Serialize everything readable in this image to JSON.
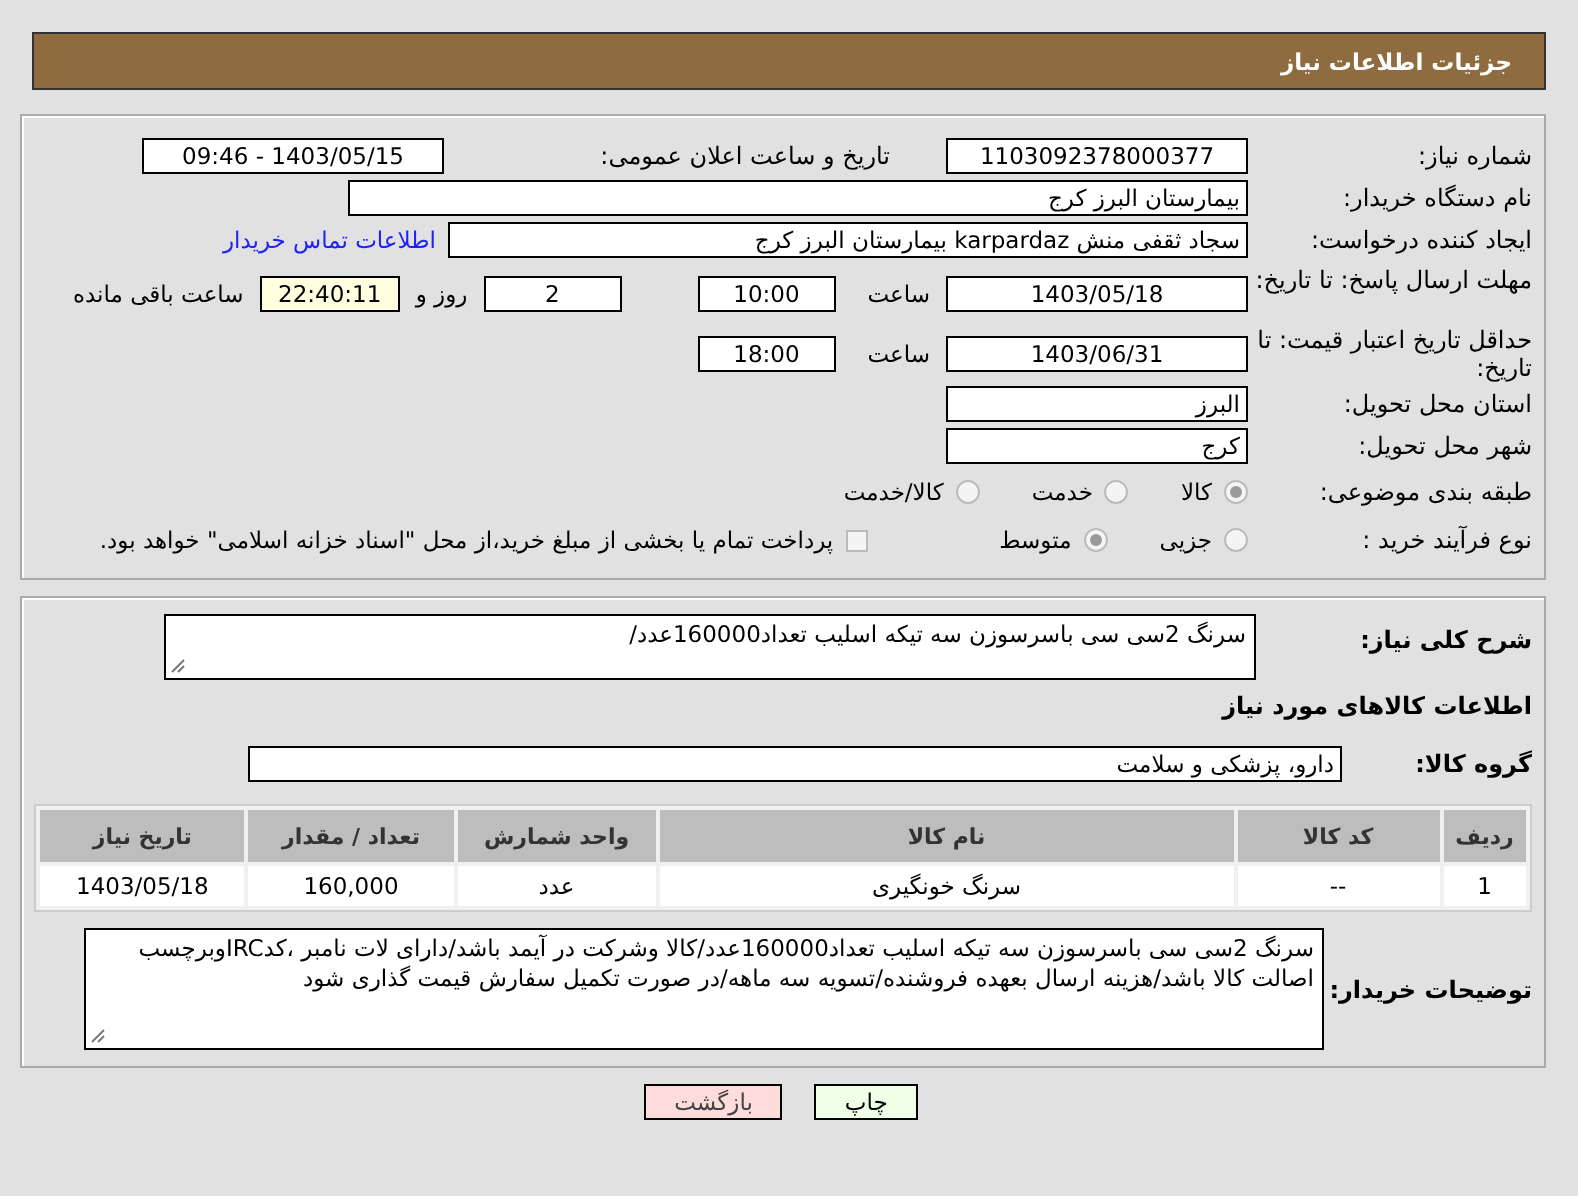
{
  "header": {
    "title": "جزئیات اطلاعات نیاز"
  },
  "need_number": {
    "label": "شماره نیاز:",
    "value": "1103092378000377"
  },
  "announce": {
    "label": "تاریخ و ساعت اعلان عمومی:",
    "value": "1403/05/15 - 09:46"
  },
  "buyer": {
    "label": "نام دستگاه خریدار:",
    "value": "بیمارستان البرز کرج"
  },
  "requester": {
    "label": "ایجاد کننده درخواست:",
    "value": "سجاد ثقفی منش karpardaz بیمارستان البرز کرج",
    "link": "اطلاعات تماس خریدار"
  },
  "reply_deadline": {
    "label": "مهلت ارسال پاسخ: تا تاریخ:",
    "date": "1403/05/18",
    "time_label": "ساعت",
    "time": "10:00",
    "days": "2",
    "days_label": "روز و",
    "remaining": "22:40:11",
    "remaining_label": "ساعت باقی مانده"
  },
  "price_validity": {
    "label": "حداقل تاریخ اعتبار قیمت: تا تاریخ:",
    "date": "1403/06/31",
    "time_label": "ساعت",
    "time": "18:00"
  },
  "province": {
    "label": "استان محل تحویل:",
    "value": "البرز"
  },
  "city": {
    "label": "شهر محل تحویل:",
    "value": "کرج"
  },
  "category": {
    "label": "طبقه بندی موضوعی:",
    "options": [
      {
        "label": "کالا",
        "selected": true
      },
      {
        "label": "خدمت",
        "selected": false
      },
      {
        "label": "کالا/خدمت",
        "selected": false
      }
    ]
  },
  "process": {
    "label": "نوع فرآیند خرید :",
    "options": [
      {
        "label": "جزیی",
        "selected": false
      },
      {
        "label": "متوسط",
        "selected": true
      }
    ],
    "treasury": {
      "label": "پرداخت تمام یا بخشی از مبلغ خرید،از محل \"اسناد خزانه اسلامی\" خواهد بود.",
      "checked": false
    }
  },
  "description": {
    "label": "شرح کلی نیاز:",
    "value": "سرنگ 2سی سی باسرسوزن سه تیکه اسلیب تعداد160000عدد/"
  },
  "goods_title": "اطلاعات کالاهای مورد نیاز",
  "goods_group": {
    "label": "گروه کالا:",
    "value": "دارو، پزشکی و سلامت"
  },
  "table": {
    "columns": [
      "ردیف",
      "کد کالا",
      "نام کالا",
      "واحد شمارش",
      "تعداد / مقدار",
      "تاریخ نیاز"
    ],
    "rows": [
      [
        "1",
        "--",
        "سرنگ خونگیری",
        "عدد",
        "160,000",
        "1403/05/18"
      ]
    ]
  },
  "notes": {
    "label": "توضیحات خریدار:",
    "value": "سرنگ 2سی سی باسرسوزن سه تیکه اسلیب تعداد160000عدد/کالا وشرکت در آیمد باشد/دارای لات نامبر ،کدIRCوبرچسب اصالت کالا باشد/هزینه ارسال بعهده فروشنده/تسویه سه ماهه/در صورت تکمیل سفارش قیمت گذاری شود"
  },
  "buttons": [
    {
      "label": "چاپ",
      "kind": "print"
    },
    {
      "label": "بازگشت",
      "kind": "back"
    }
  ]
}
